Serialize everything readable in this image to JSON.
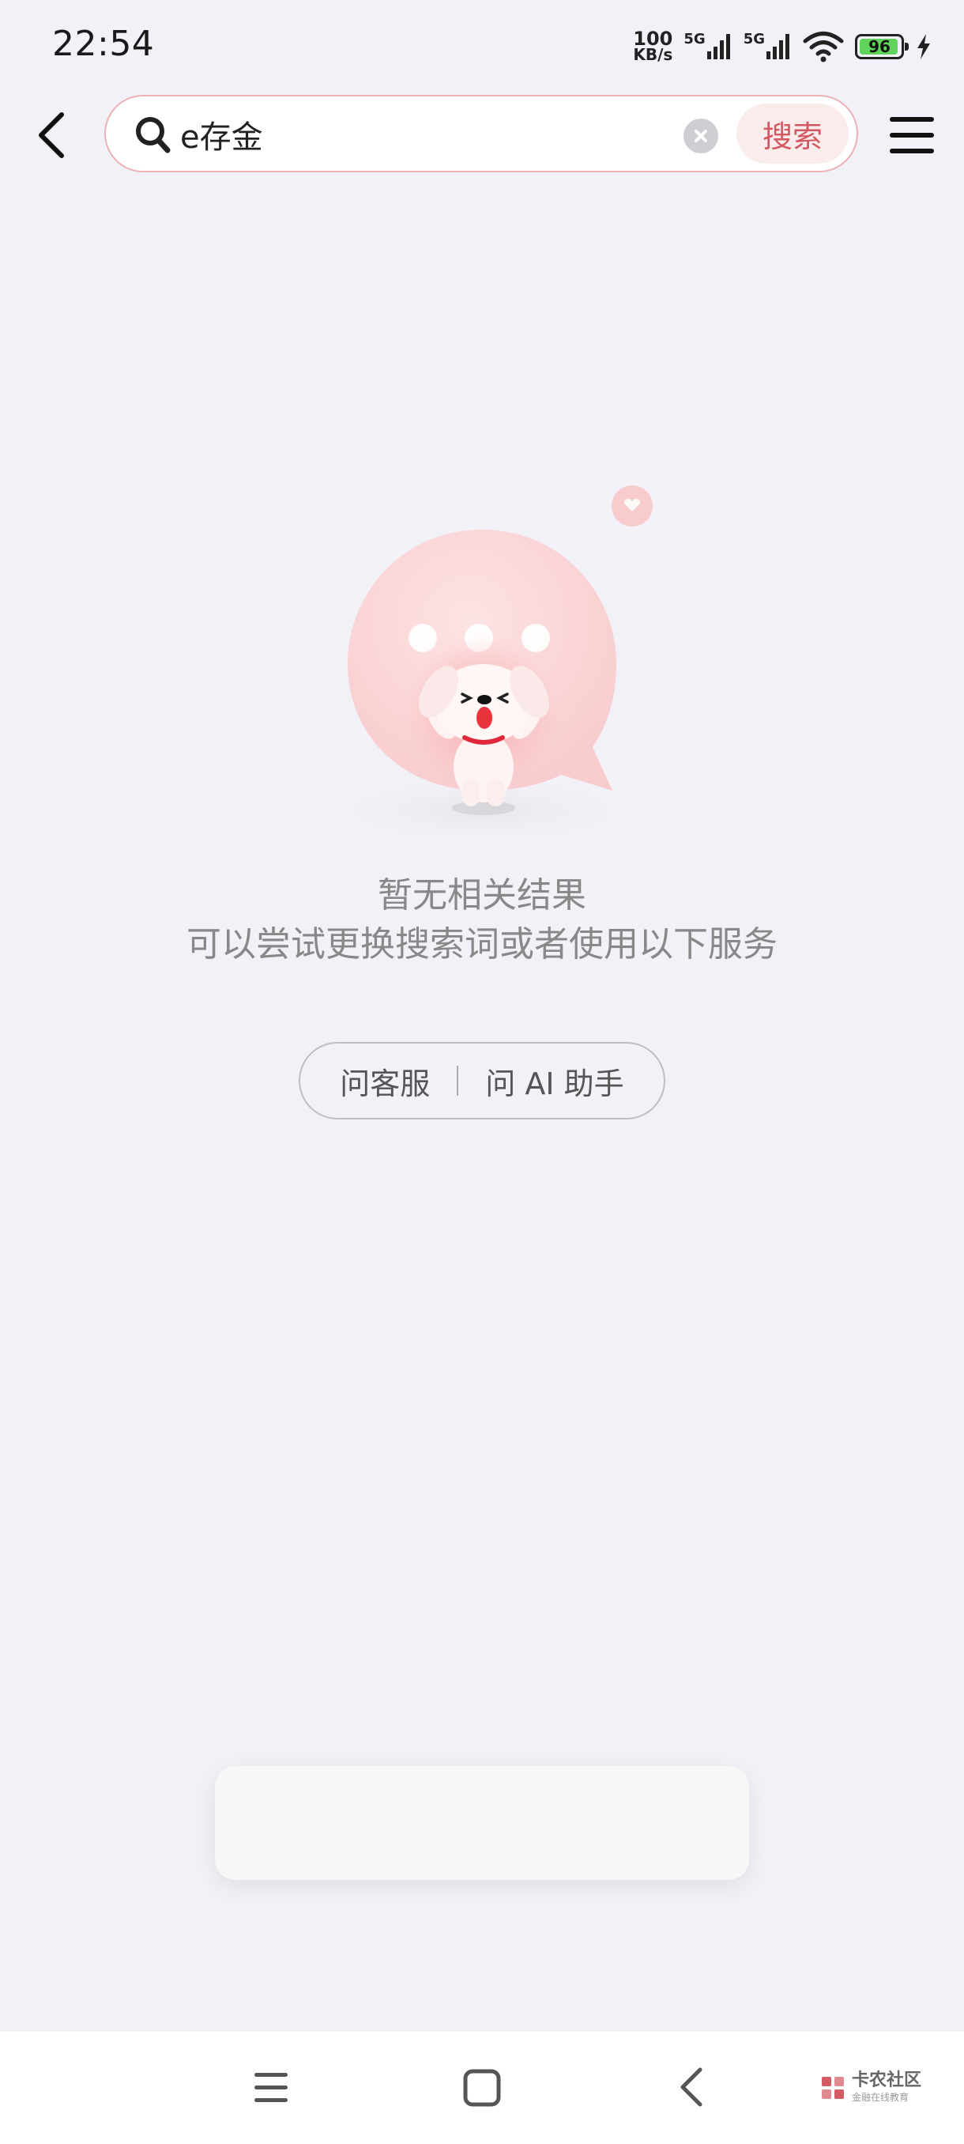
{
  "status_bar": {
    "time": "22:54",
    "net_speed_value": "100",
    "net_speed_unit": "KB/s",
    "signal_1_label": "5G",
    "signal_2_label": "5G",
    "battery_level": "96",
    "battery_color": "#5fd35a"
  },
  "header": {
    "search_value": "e存金",
    "search_button_label": "搜索",
    "accent_color": "#d25862"
  },
  "empty_state": {
    "title": "暂无相关结果",
    "subtitle": "可以尝试更换搜索词或者使用以下服务"
  },
  "services": {
    "customer_service_label": "问客服",
    "ai_assistant_label": "问 AI 助手"
  },
  "watermark": {
    "title": "卡农社区",
    "subtitle": "金融在线教育"
  }
}
